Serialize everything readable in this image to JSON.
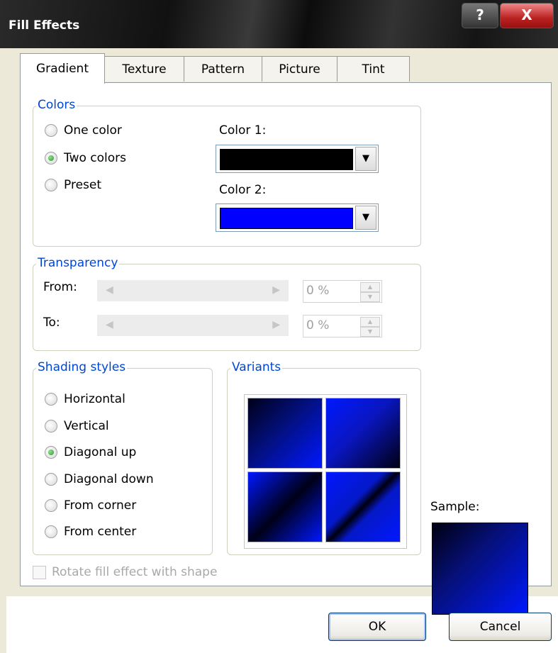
{
  "window": {
    "title": "Fill Effects",
    "help_label": "?",
    "close_label": "X"
  },
  "tabs": [
    {
      "label": "Gradient",
      "active": true
    },
    {
      "label": "Texture",
      "active": false
    },
    {
      "label": "Pattern",
      "active": false
    },
    {
      "label": "Picture",
      "active": false
    },
    {
      "label": "Tint",
      "active": false
    }
  ],
  "colors": {
    "legend": "Colors",
    "options": [
      {
        "label": "One color",
        "selected": false
      },
      {
        "label": "Two colors",
        "selected": true
      },
      {
        "label": "Preset",
        "selected": false
      }
    ],
    "color1_label": "Color 1:",
    "color1_value": "#000000",
    "color2_label": "Color 2:",
    "color2_value": "#0000ff"
  },
  "transparency": {
    "legend": "Transparency",
    "from_label": "From:",
    "from_value": "0 %",
    "to_label": "To:",
    "to_value": "0 %"
  },
  "shading": {
    "legend": "Shading styles",
    "options": [
      {
        "label": "Horizontal",
        "selected": false
      },
      {
        "label": "Vertical",
        "selected": false
      },
      {
        "label": "Diagonal up",
        "selected": true
      },
      {
        "label": "Diagonal down",
        "selected": false
      },
      {
        "label": "From corner",
        "selected": false
      },
      {
        "label": "From center",
        "selected": false
      }
    ]
  },
  "variants": {
    "legend": "Variants"
  },
  "sample": {
    "label": "Sample:"
  },
  "rotate_checkbox": {
    "label": "Rotate fill effect with shape",
    "checked": false,
    "enabled": false
  },
  "buttons": {
    "ok": "OK",
    "cancel": "Cancel"
  }
}
